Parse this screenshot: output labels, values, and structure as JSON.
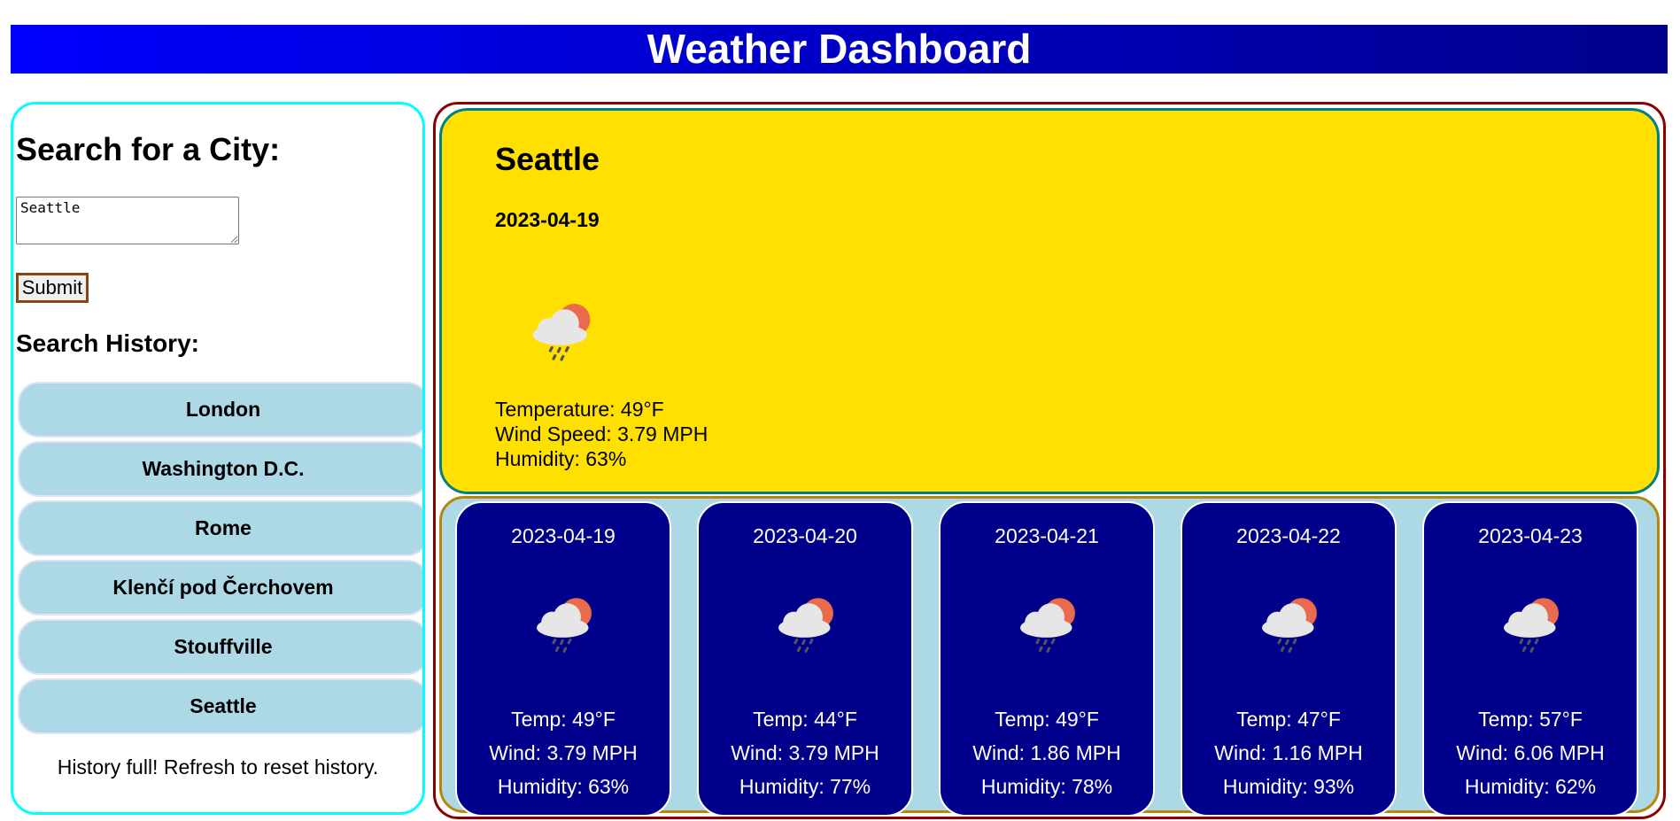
{
  "header": {
    "title": "Weather Dashboard"
  },
  "sidebar": {
    "search_title": "Search for a City:",
    "input_value": "Seattle",
    "submit_label": "Submit",
    "history_title": "Search History:",
    "history": [
      "London",
      "Washington D.C.",
      "Rome",
      "Klenčí pod Čerchovem",
      "Stouffville",
      "Seattle"
    ],
    "note": "History full! Refresh to reset history."
  },
  "current": {
    "city": "Seattle",
    "date": "2023-04-19",
    "icon": "cloud-sun-rain-icon",
    "temperature": "Temperature: 49°F",
    "wind": "Wind Speed: 3.79 MPH",
    "humidity": "Humidity: 63%"
  },
  "forecast": [
    {
      "date": "2023-04-19",
      "icon": "cloud-sun-rain-icon",
      "temp": "Temp: 49°F",
      "wind": "Wind: 3.79 MPH",
      "humidity": "Humidity: 63%"
    },
    {
      "date": "2023-04-20",
      "icon": "cloud-sun-rain-icon",
      "temp": "Temp: 44°F",
      "wind": "Wind: 3.79 MPH",
      "humidity": "Humidity: 77%"
    },
    {
      "date": "2023-04-21",
      "icon": "cloud-sun-rain-icon",
      "temp": "Temp: 49°F",
      "wind": "Wind: 1.86 MPH",
      "humidity": "Humidity: 78%"
    },
    {
      "date": "2023-04-22",
      "icon": "cloud-sun-rain-icon",
      "temp": "Temp: 47°F",
      "wind": "Wind: 1.16 MPH",
      "humidity": "Humidity: 93%"
    },
    {
      "date": "2023-04-23",
      "icon": "cloud-sun-rain-icon",
      "temp": "Temp: 57°F",
      "wind": "Wind: 6.06 MPH",
      "humidity": "Humidity: 62%"
    }
  ],
  "colors": {
    "header_gradient": [
      "#0000ff",
      "#00008b"
    ],
    "current_bg": "#ffe000",
    "forecast_bg": "#add8e6",
    "card_bg": "#00008b",
    "history_bg": "#add8e6",
    "sidebar_border": "#00ffff"
  }
}
